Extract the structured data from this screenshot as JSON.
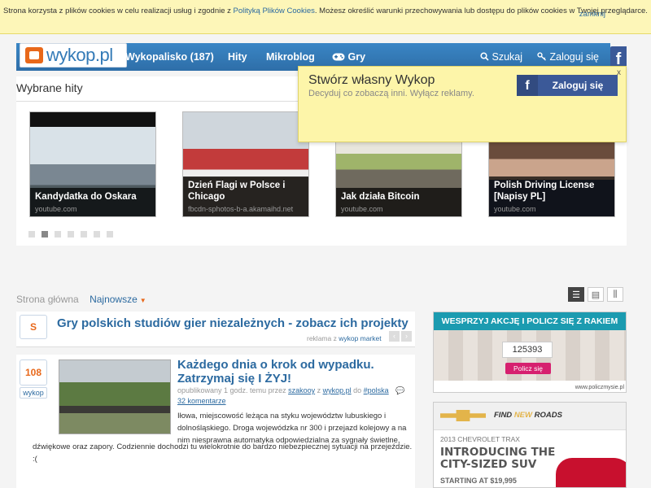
{
  "cookie": {
    "text_before": "Strona korzysta z plików cookies w celu realizacji usług i zgodnie z ",
    "policy_link": "Polityką Plików Cookies",
    "text_after": ". Możesz określić warunki przechowywania lub dostępu do plików cookies w Twojej przeglądarce.",
    "close": "zamknij"
  },
  "nav": {
    "logo": "wykop.pl",
    "items": [
      "Wykopalisko (187)",
      "Hity",
      "Mikroblog",
      "Gry"
    ],
    "search": "Szukaj",
    "login": "Zaloguj się",
    "fb": "f"
  },
  "hits": {
    "title": "Wybrane hity",
    "items": [
      {
        "title": "Kandydatka do Oskara",
        "source": "youtube.com"
      },
      {
        "title": "Dzień Flagi w Polsce i Chicago",
        "source": "fbcdn-sphotos-b-a.akamaihd.net"
      },
      {
        "title": "Jak działa Bitcoin",
        "source": "youtube.com"
      },
      {
        "title": "Polish Driving License [Napisy PL]",
        "source": "youtube.com"
      }
    ],
    "dots_total": 7,
    "dots_active": 1
  },
  "popup": {
    "title": "Stwórz własny Wykop",
    "subtitle": "Decyduj co zobaczą inni. Wyłącz reklamy.",
    "close": "x",
    "fb_button": "Zaloguj się",
    "fb_icon": "f"
  },
  "feed": {
    "crumb_home": "Strona główna",
    "crumb_sort": "Najnowsze",
    "promo": {
      "badge": "S",
      "title": "Gry polskich studiów gier niezależnych - zobacz ich projekty",
      "sub_prefix": "reklama z ",
      "sub_link": "wykop market"
    },
    "entry": {
      "votes": "108",
      "vote_label": "wykop",
      "title": "Każdego dnia o krok od wypadku. Zatrzymaj się I ŻYJ!",
      "meta_prefix": "opublikowany 1 godz. temu przez ",
      "meta_author": "szakooy",
      "meta_mid": " z ",
      "meta_domain": "wykop.pl",
      "meta_to": " do ",
      "meta_tag": "#polska",
      "comments": "32 komentarze",
      "desc1": "Iłowa, miejscowość leżąca na styku województw lubuskiego i dolnośląskiego. Droga wojewódzka nr 300 i przejazd kolejowy a na nim niesprawna automatyka odpowiedzialna za sygnały świetlne,",
      "desc2": "dźwiękowe oraz zapory. Codziennie dochodzi tu wielokrotnie do bardzo niebezpiecznej sytuacji na przejeździe. :("
    }
  },
  "ads": {
    "ad1": {
      "header": "WESPRZYJ AKCJĘ I POLICZ SIĘ Z RAKIEM",
      "counter": "125393",
      "button": "Policz się",
      "footer": "www.policzmysie.pl"
    },
    "ad2": {
      "find": "FIND",
      "new": "NEW",
      "roads": "ROADS",
      "model": "2013 CHEVROLET TRAX",
      "headline1": "INTRODUCING THE",
      "headline2": "CITY-SIZED SUV",
      "price": "STARTING AT $19,995"
    }
  },
  "colors": {
    "nav_blue": "#337ab7",
    "accent_orange": "#e8681a",
    "facebook": "#3b5998",
    "popup_yellow": "#fdf5a9",
    "link_blue": "#2c6aa0"
  }
}
